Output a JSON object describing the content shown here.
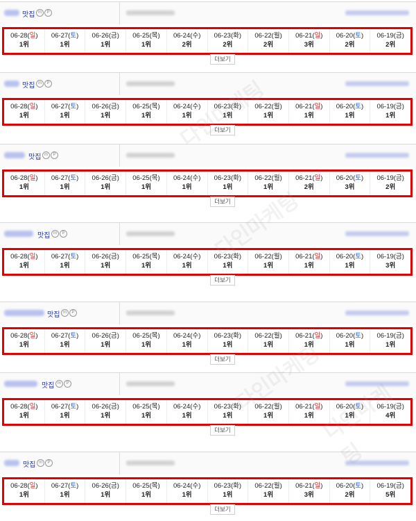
{
  "more_label": "더보기",
  "watermark": "다인마케팅",
  "accent_color": "#e30000",
  "sunday_color": "#e02020",
  "saturday_color": "#2255cc",
  "blocks": [
    {
      "title": "맛집",
      "dates": [
        {
          "date": "06-28",
          "day": "일",
          "rank": "1위"
        },
        {
          "date": "06-27",
          "day": "토",
          "rank": "1위"
        },
        {
          "date": "06-26",
          "day": "금",
          "rank": "1위"
        },
        {
          "date": "06-25",
          "day": "목",
          "rank": "1위"
        },
        {
          "date": "06-24",
          "day": "수",
          "rank": "2위"
        },
        {
          "date": "06-23",
          "day": "화",
          "rank": "2위"
        },
        {
          "date": "06-22",
          "day": "월",
          "rank": "2위"
        },
        {
          "date": "06-21",
          "day": "일",
          "rank": "3위"
        },
        {
          "date": "06-20",
          "day": "토",
          "rank": "2위"
        },
        {
          "date": "06-19",
          "day": "금",
          "rank": "2위"
        }
      ]
    },
    {
      "title": "맛집",
      "dates": [
        {
          "date": "06-28",
          "day": "일",
          "rank": "1위"
        },
        {
          "date": "06-27",
          "day": "토",
          "rank": "1위"
        },
        {
          "date": "06-26",
          "day": "금",
          "rank": "1위"
        },
        {
          "date": "06-25",
          "day": "목",
          "rank": "1위"
        },
        {
          "date": "06-24",
          "day": "수",
          "rank": "1위"
        },
        {
          "date": "06-23",
          "day": "화",
          "rank": "1위"
        },
        {
          "date": "06-22",
          "day": "월",
          "rank": "1위"
        },
        {
          "date": "06-21",
          "day": "일",
          "rank": "1위"
        },
        {
          "date": "06-20",
          "day": "토",
          "rank": "1위"
        },
        {
          "date": "06-19",
          "day": "금",
          "rank": "1위"
        }
      ]
    },
    {
      "title": "맛집",
      "dates": [
        {
          "date": "06-28",
          "day": "일",
          "rank": "1위"
        },
        {
          "date": "06-27",
          "day": "토",
          "rank": "1위"
        },
        {
          "date": "06-26",
          "day": "금",
          "rank": "1위"
        },
        {
          "date": "06-25",
          "day": "목",
          "rank": "1위"
        },
        {
          "date": "06-24",
          "day": "수",
          "rank": "1위"
        },
        {
          "date": "06-23",
          "day": "화",
          "rank": "1위"
        },
        {
          "date": "06-22",
          "day": "월",
          "rank": "1위"
        },
        {
          "date": "06-21",
          "day": "일",
          "rank": "2위"
        },
        {
          "date": "06-20",
          "day": "토",
          "rank": "3위"
        },
        {
          "date": "06-19",
          "day": "금",
          "rank": "2위"
        }
      ]
    },
    {
      "title": "맛집",
      "dates": [
        {
          "date": "06-28",
          "day": "일",
          "rank": "1위"
        },
        {
          "date": "06-27",
          "day": "토",
          "rank": "1위"
        },
        {
          "date": "06-26",
          "day": "금",
          "rank": "1위"
        },
        {
          "date": "06-25",
          "day": "목",
          "rank": "1위"
        },
        {
          "date": "06-24",
          "day": "수",
          "rank": "1위"
        },
        {
          "date": "06-23",
          "day": "화",
          "rank": "1위"
        },
        {
          "date": "06-22",
          "day": "월",
          "rank": "1위"
        },
        {
          "date": "06-21",
          "day": "일",
          "rank": "1위"
        },
        {
          "date": "06-20",
          "day": "토",
          "rank": "1위"
        },
        {
          "date": "06-19",
          "day": "금",
          "rank": "3위"
        }
      ]
    },
    {
      "title": "맛집",
      "dates": [
        {
          "date": "06-28",
          "day": "일",
          "rank": "1위"
        },
        {
          "date": "06-27",
          "day": "토",
          "rank": "1위"
        },
        {
          "date": "06-26",
          "day": "금",
          "rank": "1위"
        },
        {
          "date": "06-25",
          "day": "목",
          "rank": "1위"
        },
        {
          "date": "06-24",
          "day": "수",
          "rank": "1위"
        },
        {
          "date": "06-23",
          "day": "화",
          "rank": "1위"
        },
        {
          "date": "06-22",
          "day": "월",
          "rank": "1위"
        },
        {
          "date": "06-21",
          "day": "일",
          "rank": "1위"
        },
        {
          "date": "06-20",
          "day": "토",
          "rank": "1위"
        },
        {
          "date": "06-19",
          "day": "금",
          "rank": "1위"
        }
      ]
    },
    {
      "title": "맛집",
      "dates": [
        {
          "date": "06-28",
          "day": "일",
          "rank": "1위"
        },
        {
          "date": "06-27",
          "day": "토",
          "rank": "1위"
        },
        {
          "date": "06-26",
          "day": "금",
          "rank": "1위"
        },
        {
          "date": "06-25",
          "day": "목",
          "rank": "1위"
        },
        {
          "date": "06-24",
          "day": "수",
          "rank": "1위"
        },
        {
          "date": "06-23",
          "day": "화",
          "rank": "1위"
        },
        {
          "date": "06-22",
          "day": "월",
          "rank": "1위"
        },
        {
          "date": "06-21",
          "day": "일",
          "rank": "1위"
        },
        {
          "date": "06-20",
          "day": "토",
          "rank": "1위"
        },
        {
          "date": "06-19",
          "day": "금",
          "rank": "4위"
        }
      ]
    },
    {
      "title": "맛집",
      "dates": [
        {
          "date": "06-28",
          "day": "일",
          "rank": "1위"
        },
        {
          "date": "06-27",
          "day": "토",
          "rank": "1위"
        },
        {
          "date": "06-26",
          "day": "금",
          "rank": "1위"
        },
        {
          "date": "06-25",
          "day": "목",
          "rank": "1위"
        },
        {
          "date": "06-24",
          "day": "수",
          "rank": "1위"
        },
        {
          "date": "06-23",
          "day": "화",
          "rank": "1위"
        },
        {
          "date": "06-22",
          "day": "월",
          "rank": "1위"
        },
        {
          "date": "06-21",
          "day": "일",
          "rank": "3위"
        },
        {
          "date": "06-20",
          "day": "토",
          "rank": "2위"
        },
        {
          "date": "06-19",
          "day": "금",
          "rank": "5위"
        }
      ]
    }
  ]
}
